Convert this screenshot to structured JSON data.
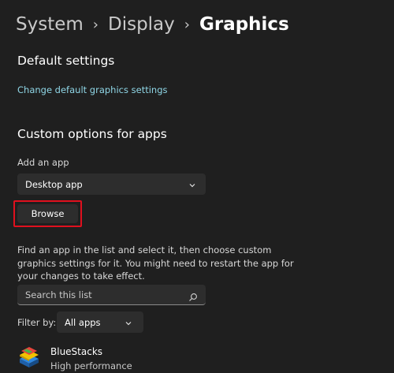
{
  "breadcrumb": {
    "items": [
      "System",
      "Display",
      "Graphics"
    ],
    "separator": "›"
  },
  "default_settings": {
    "heading": "Default settings",
    "link": "Change default graphics settings"
  },
  "custom_options": {
    "heading": "Custom options for apps",
    "add_app_label": "Add an app",
    "app_type_selected": "Desktop app",
    "browse_label": "Browse",
    "description": "Find an app in the list and select it, then choose custom graphics settings for it. You might need to restart the app for your changes to take effect.",
    "search_placeholder": "Search this list",
    "filter_label": "Filter by:",
    "filter_selected": "All apps"
  },
  "apps": [
    {
      "name": "BlueStacks",
      "preference": "High performance",
      "icon": "bluestacks-icon"
    }
  ],
  "colors": {
    "background": "#1f1f1f",
    "control": "#2d2d2d",
    "link": "#8fd6e6",
    "highlight": "#e0101e"
  }
}
